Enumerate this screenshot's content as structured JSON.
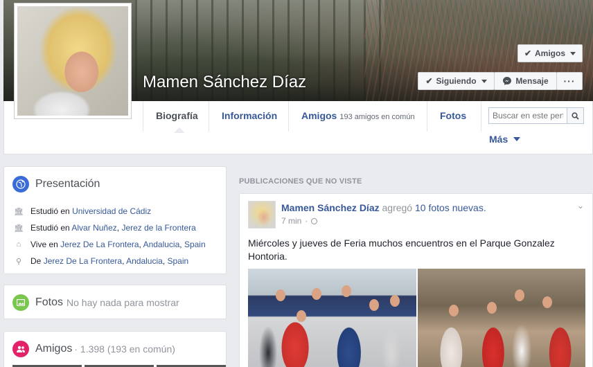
{
  "profile": {
    "name": "Mamen Sánchez Díaz"
  },
  "cover_buttons": {
    "amigos": "Amigos",
    "siguiendo": "Siguiendo",
    "mensaje": "Mensaje",
    "more": "···"
  },
  "nav": {
    "tabs": [
      {
        "label": "Biografía"
      },
      {
        "label": "Información"
      },
      {
        "label": "Amigos",
        "sub": "193 amigos en común"
      },
      {
        "label": "Fotos"
      }
    ],
    "more_label": "Más",
    "search_placeholder": "Buscar en este perfil"
  },
  "intro": {
    "title": "Presentación",
    "rows": [
      {
        "prefix": "Estudió en",
        "link1": "Universidad de Cádiz"
      },
      {
        "prefix": "Estudió en",
        "link1": "Alvar Nuñez",
        "link2": "Jerez de la Frontera"
      },
      {
        "prefix": "Vive en",
        "link1": "Jerez De La Frontera",
        "link2": "Andalucia",
        "link3": "Spain"
      },
      {
        "prefix": "De",
        "link1": "Jerez De La Frontera",
        "link2": "Andalucia",
        "link3": "Spain"
      }
    ]
  },
  "photos_card": {
    "title": "Fotos",
    "empty_text": "No hay nada para mostrar"
  },
  "friends_card": {
    "title": "Amigos",
    "count_text": "1.398 (193 en común)"
  },
  "feed": {
    "header": "PUBLICACIONES QUE NO VISTE",
    "post": {
      "author": "Mamen Sánchez Díaz",
      "action": "agregó",
      "link": "10 fotos nuevas.",
      "time": "7 min",
      "text": "Miércoles y jueves de Feria muchos encuentros en el Parque Gonzalez Hontoria."
    }
  },
  "colors": {
    "link": "#365899",
    "background": "#e9ebee"
  }
}
